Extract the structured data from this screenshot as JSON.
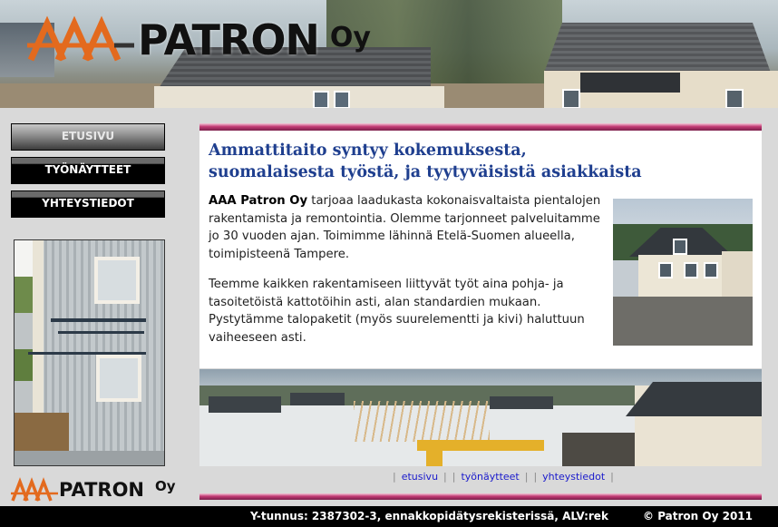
{
  "brand": {
    "logo_mark": "AAA",
    "name": "PATRON",
    "suffix": "Oy",
    "accent_color": "#e36a1e"
  },
  "nav": {
    "items": [
      {
        "label": "ETUSIVU",
        "active": true
      },
      {
        "label": "TYÖNÄYTTEET",
        "active": false
      },
      {
        "label": "YHTEYSTIEDOT",
        "active": false
      }
    ]
  },
  "main": {
    "heading_line1": "Ammattitaito syntyy kokemuksesta,",
    "heading_line2": "suomalaisesta työstä, ja tyytyväisistä asiakkaista",
    "para1_company": "AAA Patron Oy",
    "para1_text": " tarjoaa laadukasta kokonaisvaltaista pientalojen rakentamista ja remontointia. Olemme tarjonneet palveluitamme jo 30 vuoden ajan. Toimimme lähinnä Etelä-Suomen alueella, toimipisteenä Tampere.",
    "para2_text": "Teemme kaikken rakentamiseen liittyvät työt aina pohja- ja tasoitetöistä kattotöihin asti, alan standardien mukaan. Pystytämme talopaketit (myös suurelementti ja kivi) haluttuun vaiheeseen asti.",
    "heading_color": "#1f3f8f"
  },
  "bottom_links": [
    "etusivu",
    "työnäytteet",
    "yhteystiedot"
  ],
  "footer": {
    "left_text": "Y-tunnus: 2387302-3, ennakkopidätysrekisterissä, ALV:rek",
    "right_text": "© Patron Oy 2011"
  }
}
